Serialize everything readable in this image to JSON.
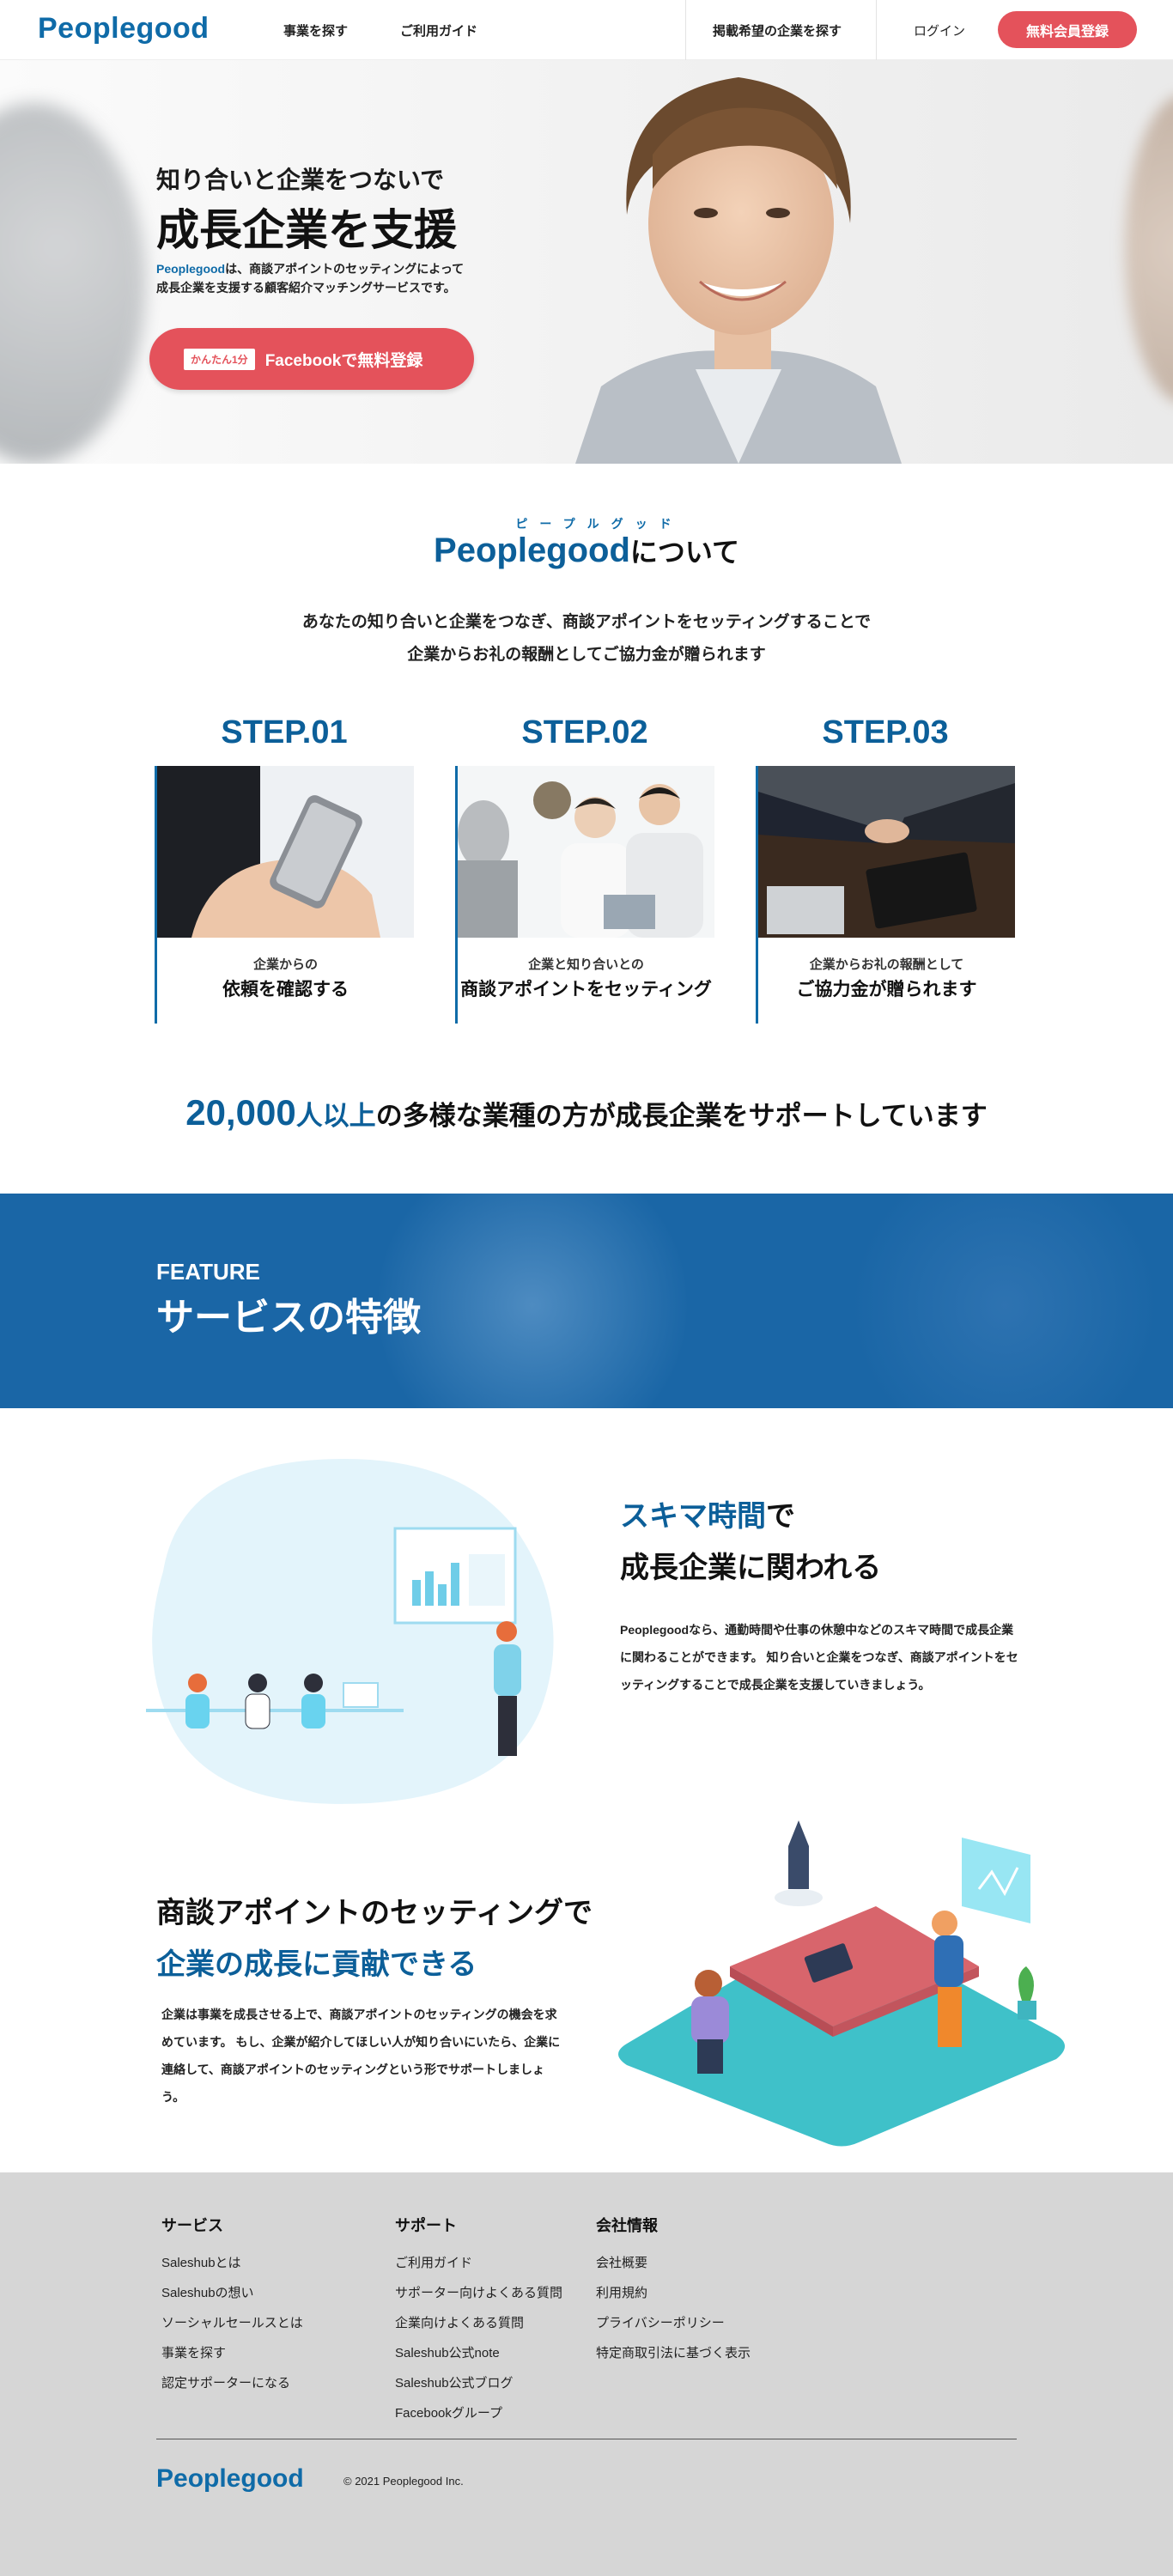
{
  "header": {
    "logo": "Peoplegood",
    "nav": [
      "事業を探す",
      "ご利用ガイド"
    ],
    "nav_right": "掲載希望の企業を探す",
    "login": "ログイン",
    "register": "無料会員登録"
  },
  "hero": {
    "subtitle": "知り合いと企業をつないで",
    "title": "成長企業を支援",
    "desc_brand": "Peoplegood",
    "desc_rest": "は、商談アポイントのセッティングによって",
    "desc_line2": "成長企業を支援する顧客紹介マッチングサービスです。",
    "fb_badge": "かんたん1分",
    "fb_label": "Facebookで無料登録"
  },
  "about": {
    "ruby": "ピープルグッド",
    "title_brand": "Peoplegood",
    "title_rest": "について",
    "lead1": "あなたの知り合いと企業をつなぎ、商談アポイントをセッティングすることで",
    "lead2": "企業からお礼の報酬としてご協力金が贈られます",
    "steps": [
      {
        "label": "STEP.01",
        "small": "企業からの",
        "big": "依頼を確認する"
      },
      {
        "label": "STEP.02",
        "small": "企業と知り合いとの",
        "big": "商談アポイントをセッティング"
      },
      {
        "label": "STEP.03",
        "small": "企業からお礼の報酬として",
        "big": "ご協力金が贈られます"
      }
    ],
    "stat_num": "20,000",
    "stat_mid": "人以上",
    "stat_rest": "の多様な業種の方が成長企業をサポートしています"
  },
  "feature": {
    "en": "FEATURE",
    "jp": "サービスの特徴"
  },
  "features": {
    "f1_h1_blue": "スキマ時間",
    "f1_h1_rest": "で",
    "f1_h2": "成長企業に関われる",
    "f1_body": "Peoplegoodなら、通勤時間や仕事の休憩中などのスキマ時間で成長企業に関わることができます。 知り合いと企業をつなぎ、商談アポイントをセッティングすることで成長企業を支援していきましょう。",
    "f2_h1": "商談アポイントのセッティングで",
    "f2_h2": "企業の成長に貢献できる",
    "f2_body": "企業は事業を成長させる上で、商談アポイントのセッティングの機会を求めています。 もし、企業が紹介してほしい人が知り合いにいたら、企業に連絡して、商談アポイントのセッティングという形でサポートしましょう。"
  },
  "footer": {
    "col1": {
      "title": "サービス",
      "links": [
        "Saleshubとは",
        "Saleshubの想い",
        "ソーシャルセールスとは",
        "事業を探す",
        "認定サポーターになる"
      ]
    },
    "col2": {
      "title": "サポート",
      "links": [
        "ご利用ガイド",
        "サポーター向けよくある質問",
        "企業向けよくある質問",
        "Saleshub公式note",
        "Saleshub公式ブログ",
        "Facebookグループ"
      ]
    },
    "col3": {
      "title": "会社情報",
      "links": [
        "会社概要",
        "利用規約",
        "プライバシーポリシー",
        "特定商取引法に基づく表示"
      ]
    },
    "logo": "Peoplegood",
    "copyright": "© 2021 Peoplegood Inc."
  },
  "colors": {
    "brand_blue": "#0f6ba8",
    "accent_red": "#e4525b",
    "feature_band": "#1a66a6",
    "footer_bg": "#d6d6d6"
  }
}
